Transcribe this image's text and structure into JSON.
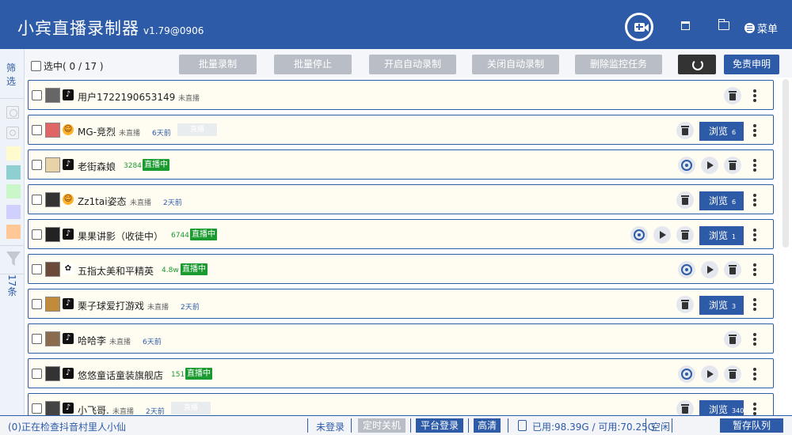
{
  "app": {
    "title": "小宾直播录制器",
    "version": "v1.79@0906",
    "menu_label": "菜单",
    "icons": [
      "add-recorder-icon",
      "window-icon",
      "folder-icon",
      "menu-icon"
    ]
  },
  "sidebar": {
    "filter_label": "筛选",
    "count_label": "17条",
    "swatch_colors": [
      "#fffbcf",
      "#8fcfd2",
      "#c9f7c9",
      "#d0d0ff",
      "#ffc896"
    ]
  },
  "toolbar": {
    "select_label": "选中( 0 / 17 )",
    "buttons": [
      "批量录制",
      "批量停止",
      "开启自动录制",
      "关闭自动录制",
      "删除监控任务"
    ],
    "disclaimer_label": "免责申明"
  },
  "rows": [
    {
      "name": "用户1722190653149",
      "platform": "tiktok",
      "status": "未直播",
      "ago": "",
      "live_num": "",
      "live": false,
      "browse": null,
      "ghost": false
    },
    {
      "name": "MG-竞烈",
      "platform": "douyu",
      "status": "未直播",
      "ago": "6天前",
      "live_num": "",
      "live": false,
      "browse": "浏览",
      "browse_count": "6",
      "ghost": true,
      "ghost_label": "直播"
    },
    {
      "name": "老街森娘",
      "platform": "tiktok",
      "status": "",
      "ago": "",
      "live_num": "3284",
      "live": true,
      "live_label": "直播中",
      "browse": null,
      "ghost": false
    },
    {
      "name": "Zz1tai姿态",
      "platform": "douyu",
      "status": "未直播",
      "ago": "2天前",
      "live_num": "",
      "live": false,
      "browse": "浏览",
      "browse_count": "6",
      "ghost": false
    },
    {
      "name": "果果讲影（收徒中）",
      "platform": "tiktok",
      "status": "",
      "ago": "",
      "live_num": "6744",
      "live": true,
      "live_label": "直播中",
      "browse": "浏览",
      "browse_count": "1",
      "ghost": false
    },
    {
      "name": "五指太美和平精英",
      "platform": "kuaishou",
      "status": "",
      "ago": "",
      "live_num": "4.8w",
      "live": true,
      "live_label": "直播中",
      "browse": null,
      "ghost": false
    },
    {
      "name": "栗子球爱打游戏",
      "platform": "tiktok",
      "status": "未直播",
      "ago": "2天前",
      "live_num": "",
      "live": false,
      "browse": "浏览",
      "browse_count": "3",
      "ghost": false
    },
    {
      "name": "哈哈李",
      "platform": "tiktok",
      "status": "未直播",
      "ago": "6天前",
      "live_num": "",
      "live": false,
      "browse": null,
      "ghost": false
    },
    {
      "name": "悠悠童话童装旗舰店",
      "platform": "tiktok",
      "status": "",
      "ago": "",
      "live_num": "151",
      "live": true,
      "live_label": "直播中",
      "browse": null,
      "ghost": false
    },
    {
      "name": "小飞哥.",
      "platform": "tiktok",
      "status": "未直播",
      "ago": "2天前",
      "live_num": "",
      "live": false,
      "browse": "浏览",
      "browse_count": "340",
      "ghost": true,
      "ghost_label": "直播"
    }
  ],
  "status_bar": {
    "message": "(0)正在检查抖音村里人小仙",
    "login_status": "未登录",
    "shutdown_btn": "定时关机",
    "platform_login_btn": "平台登录",
    "quality_btn": "高清",
    "disk_usage": "已用:98.39G / 可用:70.25G",
    "idle_label": "空闲",
    "pause_queue_btn": "暂存队列"
  }
}
